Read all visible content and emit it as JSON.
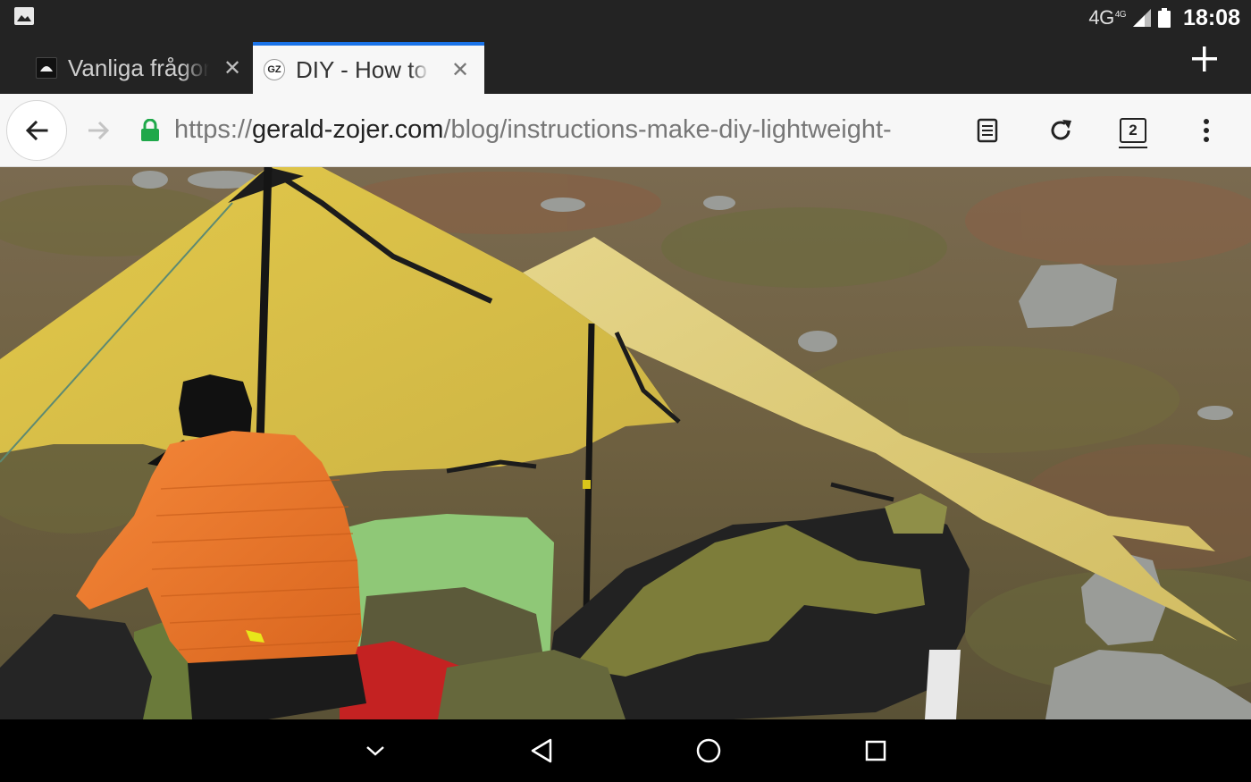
{
  "status_bar": {
    "network": "4G",
    "network_sup": "4G",
    "time": "18:08",
    "icons": [
      "gallery-notification-icon",
      "signal-icon",
      "battery-icon"
    ]
  },
  "tabs": [
    {
      "title": "Vanliga frågor",
      "favicon": "site-favicon",
      "active": false
    },
    {
      "title": "DIY - How to",
      "favicon_text": "GZ",
      "active": true
    }
  ],
  "toolbar": {
    "url_scheme": "https://",
    "url_host": "gerald-zojer.com",
    "url_path": "/blog/instructions-make-diy-lightweight-",
    "tab_count": "2",
    "icons": [
      "back-arrow-icon",
      "forward-arrow-icon",
      "lock-icon",
      "reader-mode-icon",
      "reload-icon",
      "tab-switcher-icon",
      "overflow-menu-icon"
    ]
  },
  "content": {
    "description_icon": "tarp-camping-photo"
  },
  "nav_bar": {
    "icons": [
      "hide-keyboard-icon",
      "back-triangle-icon",
      "home-circle-icon",
      "recents-square-icon"
    ]
  },
  "colors": {
    "accent": "#1a73e8",
    "lock": "#1fa84a",
    "tarp": "#d9c25a",
    "jacket": "#ee7a2c"
  }
}
